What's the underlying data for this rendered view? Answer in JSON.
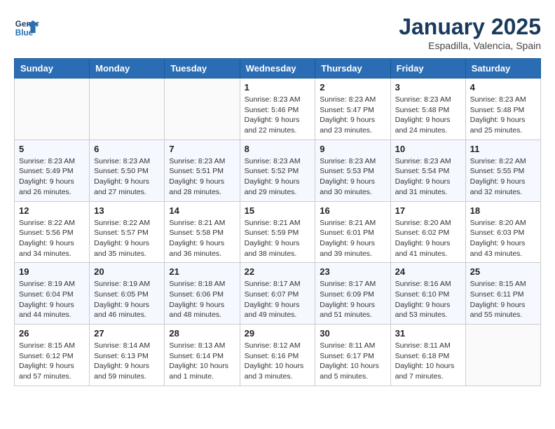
{
  "header": {
    "logo_line1": "General",
    "logo_line2": "Blue",
    "title": "January 2025",
    "subtitle": "Espadilla, Valencia, Spain"
  },
  "days_of_week": [
    "Sunday",
    "Monday",
    "Tuesday",
    "Wednesday",
    "Thursday",
    "Friday",
    "Saturday"
  ],
  "weeks": [
    [
      {
        "day": "",
        "info": ""
      },
      {
        "day": "",
        "info": ""
      },
      {
        "day": "",
        "info": ""
      },
      {
        "day": "1",
        "info": "Sunrise: 8:23 AM\nSunset: 5:46 PM\nDaylight: 9 hours\nand 22 minutes."
      },
      {
        "day": "2",
        "info": "Sunrise: 8:23 AM\nSunset: 5:47 PM\nDaylight: 9 hours\nand 23 minutes."
      },
      {
        "day": "3",
        "info": "Sunrise: 8:23 AM\nSunset: 5:48 PM\nDaylight: 9 hours\nand 24 minutes."
      },
      {
        "day": "4",
        "info": "Sunrise: 8:23 AM\nSunset: 5:48 PM\nDaylight: 9 hours\nand 25 minutes."
      }
    ],
    [
      {
        "day": "5",
        "info": "Sunrise: 8:23 AM\nSunset: 5:49 PM\nDaylight: 9 hours\nand 26 minutes."
      },
      {
        "day": "6",
        "info": "Sunrise: 8:23 AM\nSunset: 5:50 PM\nDaylight: 9 hours\nand 27 minutes."
      },
      {
        "day": "7",
        "info": "Sunrise: 8:23 AM\nSunset: 5:51 PM\nDaylight: 9 hours\nand 28 minutes."
      },
      {
        "day": "8",
        "info": "Sunrise: 8:23 AM\nSunset: 5:52 PM\nDaylight: 9 hours\nand 29 minutes."
      },
      {
        "day": "9",
        "info": "Sunrise: 8:23 AM\nSunset: 5:53 PM\nDaylight: 9 hours\nand 30 minutes."
      },
      {
        "day": "10",
        "info": "Sunrise: 8:23 AM\nSunset: 5:54 PM\nDaylight: 9 hours\nand 31 minutes."
      },
      {
        "day": "11",
        "info": "Sunrise: 8:22 AM\nSunset: 5:55 PM\nDaylight: 9 hours\nand 32 minutes."
      }
    ],
    [
      {
        "day": "12",
        "info": "Sunrise: 8:22 AM\nSunset: 5:56 PM\nDaylight: 9 hours\nand 34 minutes."
      },
      {
        "day": "13",
        "info": "Sunrise: 8:22 AM\nSunset: 5:57 PM\nDaylight: 9 hours\nand 35 minutes."
      },
      {
        "day": "14",
        "info": "Sunrise: 8:21 AM\nSunset: 5:58 PM\nDaylight: 9 hours\nand 36 minutes."
      },
      {
        "day": "15",
        "info": "Sunrise: 8:21 AM\nSunset: 5:59 PM\nDaylight: 9 hours\nand 38 minutes."
      },
      {
        "day": "16",
        "info": "Sunrise: 8:21 AM\nSunset: 6:01 PM\nDaylight: 9 hours\nand 39 minutes."
      },
      {
        "day": "17",
        "info": "Sunrise: 8:20 AM\nSunset: 6:02 PM\nDaylight: 9 hours\nand 41 minutes."
      },
      {
        "day": "18",
        "info": "Sunrise: 8:20 AM\nSunset: 6:03 PM\nDaylight: 9 hours\nand 43 minutes."
      }
    ],
    [
      {
        "day": "19",
        "info": "Sunrise: 8:19 AM\nSunset: 6:04 PM\nDaylight: 9 hours\nand 44 minutes."
      },
      {
        "day": "20",
        "info": "Sunrise: 8:19 AM\nSunset: 6:05 PM\nDaylight: 9 hours\nand 46 minutes."
      },
      {
        "day": "21",
        "info": "Sunrise: 8:18 AM\nSunset: 6:06 PM\nDaylight: 9 hours\nand 48 minutes."
      },
      {
        "day": "22",
        "info": "Sunrise: 8:17 AM\nSunset: 6:07 PM\nDaylight: 9 hours\nand 49 minutes."
      },
      {
        "day": "23",
        "info": "Sunrise: 8:17 AM\nSunset: 6:09 PM\nDaylight: 9 hours\nand 51 minutes."
      },
      {
        "day": "24",
        "info": "Sunrise: 8:16 AM\nSunset: 6:10 PM\nDaylight: 9 hours\nand 53 minutes."
      },
      {
        "day": "25",
        "info": "Sunrise: 8:15 AM\nSunset: 6:11 PM\nDaylight: 9 hours\nand 55 minutes."
      }
    ],
    [
      {
        "day": "26",
        "info": "Sunrise: 8:15 AM\nSunset: 6:12 PM\nDaylight: 9 hours\nand 57 minutes."
      },
      {
        "day": "27",
        "info": "Sunrise: 8:14 AM\nSunset: 6:13 PM\nDaylight: 9 hours\nand 59 minutes."
      },
      {
        "day": "28",
        "info": "Sunrise: 8:13 AM\nSunset: 6:14 PM\nDaylight: 10 hours\nand 1 minute."
      },
      {
        "day": "29",
        "info": "Sunrise: 8:12 AM\nSunset: 6:16 PM\nDaylight: 10 hours\nand 3 minutes."
      },
      {
        "day": "30",
        "info": "Sunrise: 8:11 AM\nSunset: 6:17 PM\nDaylight: 10 hours\nand 5 minutes."
      },
      {
        "day": "31",
        "info": "Sunrise: 8:11 AM\nSunset: 6:18 PM\nDaylight: 10 hours\nand 7 minutes."
      },
      {
        "day": "",
        "info": ""
      }
    ]
  ]
}
